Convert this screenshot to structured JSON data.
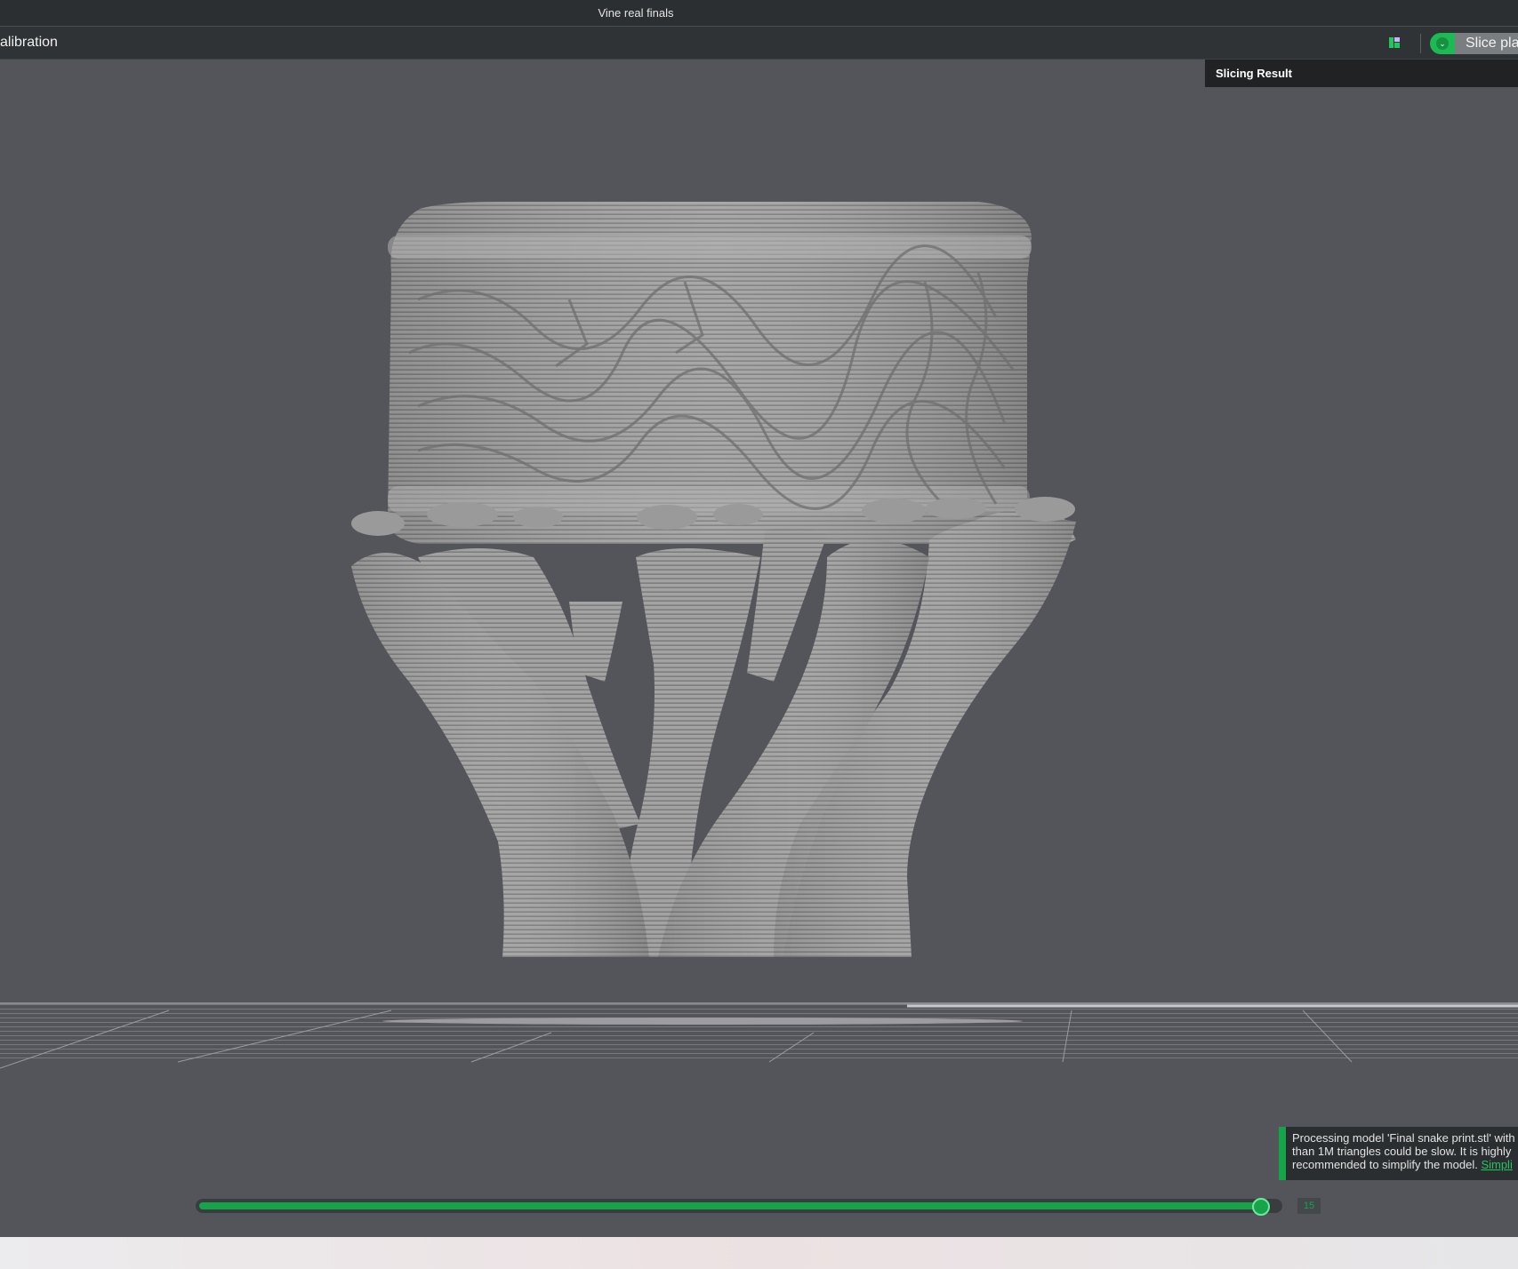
{
  "window": {
    "title": "Vine real finals"
  },
  "toolbar": {
    "left_label": "alibration",
    "layout_icon": "layout-icon",
    "slice_button_label": "Slice pla",
    "slice_toggle_icon": "chevron-down-icon"
  },
  "slicing_panel": {
    "title": "Slicing Result"
  },
  "notification": {
    "line1": "Processing model 'Final snake print.stl' with",
    "line2": "than 1M triangles could be slow. It is highly",
    "line3_text": "recommended to simplify the model. ",
    "link_text": "Simpli"
  },
  "layer_slider": {
    "value_label": "15",
    "fraction": 0.992
  },
  "colors": {
    "accent": "#16a34a",
    "viewport_bg": "#54545b",
    "model": "#a8a8a8"
  }
}
